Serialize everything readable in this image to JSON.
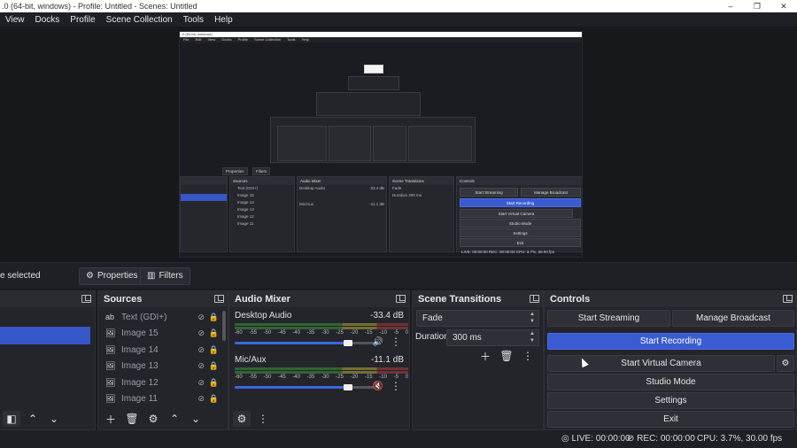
{
  "window": {
    "title": ".0 (64-bit, windows) - Profile: Untitled - Scenes: Untitled",
    "controls": [
      "–",
      "❐",
      "✕"
    ]
  },
  "menu": [
    "View",
    "Docks",
    "Profile",
    "Scene Collection",
    "Tools",
    "Help"
  ],
  "preview_nested": {
    "menu": [
      "File",
      "Edit",
      "View",
      "Docks",
      "Profile",
      "Scene Collection",
      "Tools",
      "Help"
    ],
    "tabs": [
      "Properties",
      "Filters"
    ],
    "sources_title": "Sources",
    "sources": [
      "Text (GDI+)",
      "Image 15",
      "Image 14",
      "Image 13",
      "Image 12",
      "Image 11"
    ],
    "mixer_title": "Audio Mixer",
    "desktop_audio": "Desktop Audio",
    "desktop_db": "-33.4 dB",
    "mic": "Mic/Aux",
    "mic_db": "-11.1 dB",
    "transitions_title": "Scene Transitions",
    "transition": "Fade",
    "duration_label": "Duration",
    "duration": "300 ms",
    "controls_title": "Controls",
    "buttons": [
      "Start Streaming",
      "Manage Broadcast",
      "Start Recording",
      "Start Virtual Camera",
      "Studio Mode",
      "Settings",
      "Exit"
    ],
    "status": "LIVE: 00:00:00   REC: 00:00:00   CPU: 3.7%, 30.00 fps"
  },
  "toolbar": {
    "selection": "e selected",
    "properties": "Properties",
    "filters": "Filters"
  },
  "sources": {
    "title": "Sources",
    "items": [
      {
        "label": "Text (GDI+)",
        "icon": "ab"
      },
      {
        "label": "Image 15",
        "icon": "🖼"
      },
      {
        "label": "Image 14",
        "icon": "🖼"
      },
      {
        "label": "Image 13",
        "icon": "🖼"
      },
      {
        "label": "Image 12",
        "icon": "🖼"
      },
      {
        "label": "Image 11",
        "icon": "🖼"
      }
    ]
  },
  "audio_mixer": {
    "title": "Audio Mixer",
    "channels": [
      {
        "name": "Desktop Audio",
        "db": "-33.4 dB",
        "volume": 0.8,
        "muted": false
      },
      {
        "name": "Mic/Aux",
        "db": "-11.1 dB",
        "volume": 0.8,
        "muted": true
      }
    ],
    "ticks": [
      "-60",
      "-55",
      "-50",
      "-45",
      "-40",
      "-35",
      "-30",
      "-25",
      "-20",
      "-15",
      "-10",
      "-5",
      "0"
    ]
  },
  "scene_transitions": {
    "title": "Scene Transitions",
    "transition": "Fade",
    "duration_label": "Duration",
    "duration": "300 ms"
  },
  "controls": {
    "title": "Controls",
    "start_streaming": "Start Streaming",
    "manage_broadcast": "Manage Broadcast",
    "start_recording": "Start Recording",
    "start_virtual_camera": "Start Virtual Camera",
    "studio_mode": "Studio Mode",
    "settings": "Settings",
    "exit": "Exit"
  },
  "status": {
    "live": "LIVE: 00:00:00",
    "rec": "REC: 00:00:00",
    "cpu": "CPU: 3.7%, 30.00 fps"
  },
  "colors": {
    "accent": "#3a5bd2",
    "background": "#1a1b20",
    "dock": "#24252b"
  }
}
